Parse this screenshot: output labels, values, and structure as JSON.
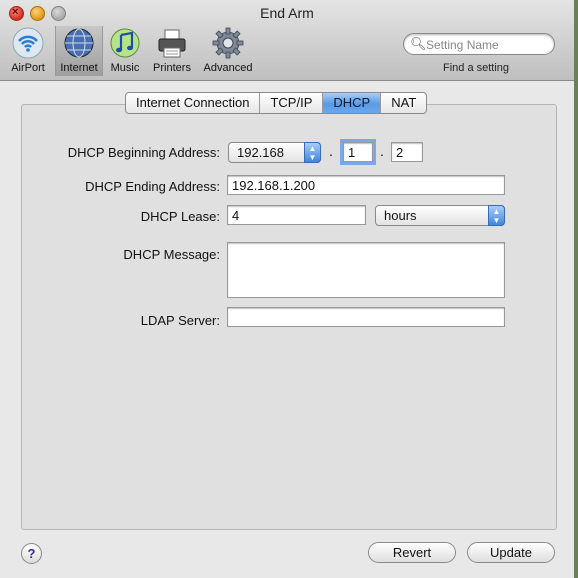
{
  "window": {
    "title": "End Arm"
  },
  "toolbar": {
    "items": [
      {
        "label": "AirPort",
        "icon": "airport-icon"
      },
      {
        "label": "Internet",
        "icon": "internet-globe-icon",
        "selected": true
      },
      {
        "label": "Music",
        "icon": "music-note-icon"
      },
      {
        "label": "Printers",
        "icon": "printer-icon"
      },
      {
        "label": "Advanced",
        "icon": "gear-icon"
      }
    ],
    "search_placeholder": "Setting Name",
    "find_label": "Find a setting"
  },
  "tabs": [
    {
      "label": "Internet Connection"
    },
    {
      "label": "TCP/IP"
    },
    {
      "label": "DHCP",
      "active": true
    },
    {
      "label": "NAT"
    }
  ],
  "form": {
    "begin_label": "DHCP Beginning Address:",
    "begin_prefix": "192.168",
    "begin_sep1": ".",
    "begin_octet3": "1",
    "begin_sep2": ".",
    "begin_octet4": "2",
    "end_label": "DHCP Ending Address:",
    "end_value": "192.168.1.200",
    "lease_label": "DHCP Lease:",
    "lease_value": "4",
    "lease_unit": "hours",
    "message_label": "DHCP Message:",
    "message_value": "",
    "ldap_label": "LDAP Server:",
    "ldap_value": ""
  },
  "footer": {
    "help": "?",
    "revert_label": "Revert",
    "update_label": "Update"
  },
  "colors": {
    "accent": "#5a9ae6",
    "window_bg": "#e8e8e8"
  }
}
